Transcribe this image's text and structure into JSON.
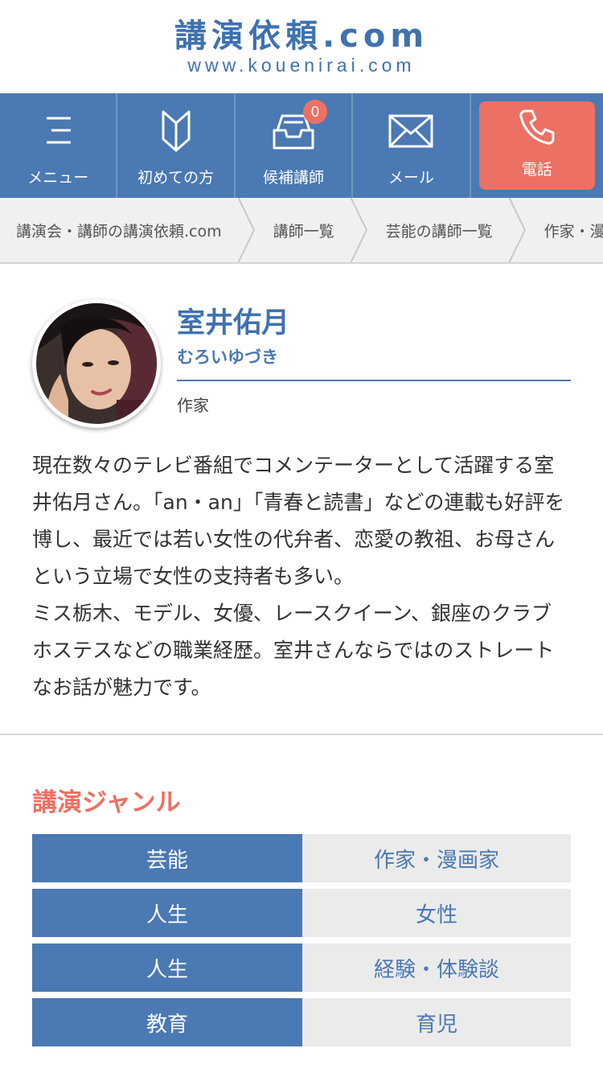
{
  "logo": {
    "main": "講演依頼.com",
    "sub": "www.kouenirai.com"
  },
  "nav": {
    "menu_label": "メニュー",
    "beginner_label": "初めての方",
    "candidates_label": "候補講師",
    "candidates_count": "0",
    "mail_label": "メール",
    "phone_label": "電話"
  },
  "breadcrumb": [
    "講演会・講師の講演依頼.com",
    "講師一覧",
    "芸能の講師一覧",
    "作家・漫画家の講師一覧"
  ],
  "profile": {
    "name": "室井佑月",
    "kana": "むろいゆづき",
    "role": "作家",
    "bio": [
      "現在数々のテレビ番組でコメンテーターとして活躍する室井佑月さん。「an・an」「青春と読書」などの連載も好評を博し、最近では若い女性の代弁者、恋愛の教祖、お母さんという立場で女性の支持者も多い。",
      "ミス栃木、モデル、女優、レースクイーン、銀座のクラブホステスなどの職業経歴。室井さんならではのストレートなお話が魅力です。"
    ]
  },
  "genre": {
    "title": "講演ジャンル",
    "rows": [
      {
        "category": "芸能",
        "sub": "作家・漫画家"
      },
      {
        "category": "人生",
        "sub": "女性"
      },
      {
        "category": "人生",
        "sub": "経験・体験談"
      },
      {
        "category": "教育",
        "sub": "育児"
      }
    ]
  },
  "colors": {
    "brand_blue": "#4a79b3",
    "accent_red": "#ec7164"
  }
}
